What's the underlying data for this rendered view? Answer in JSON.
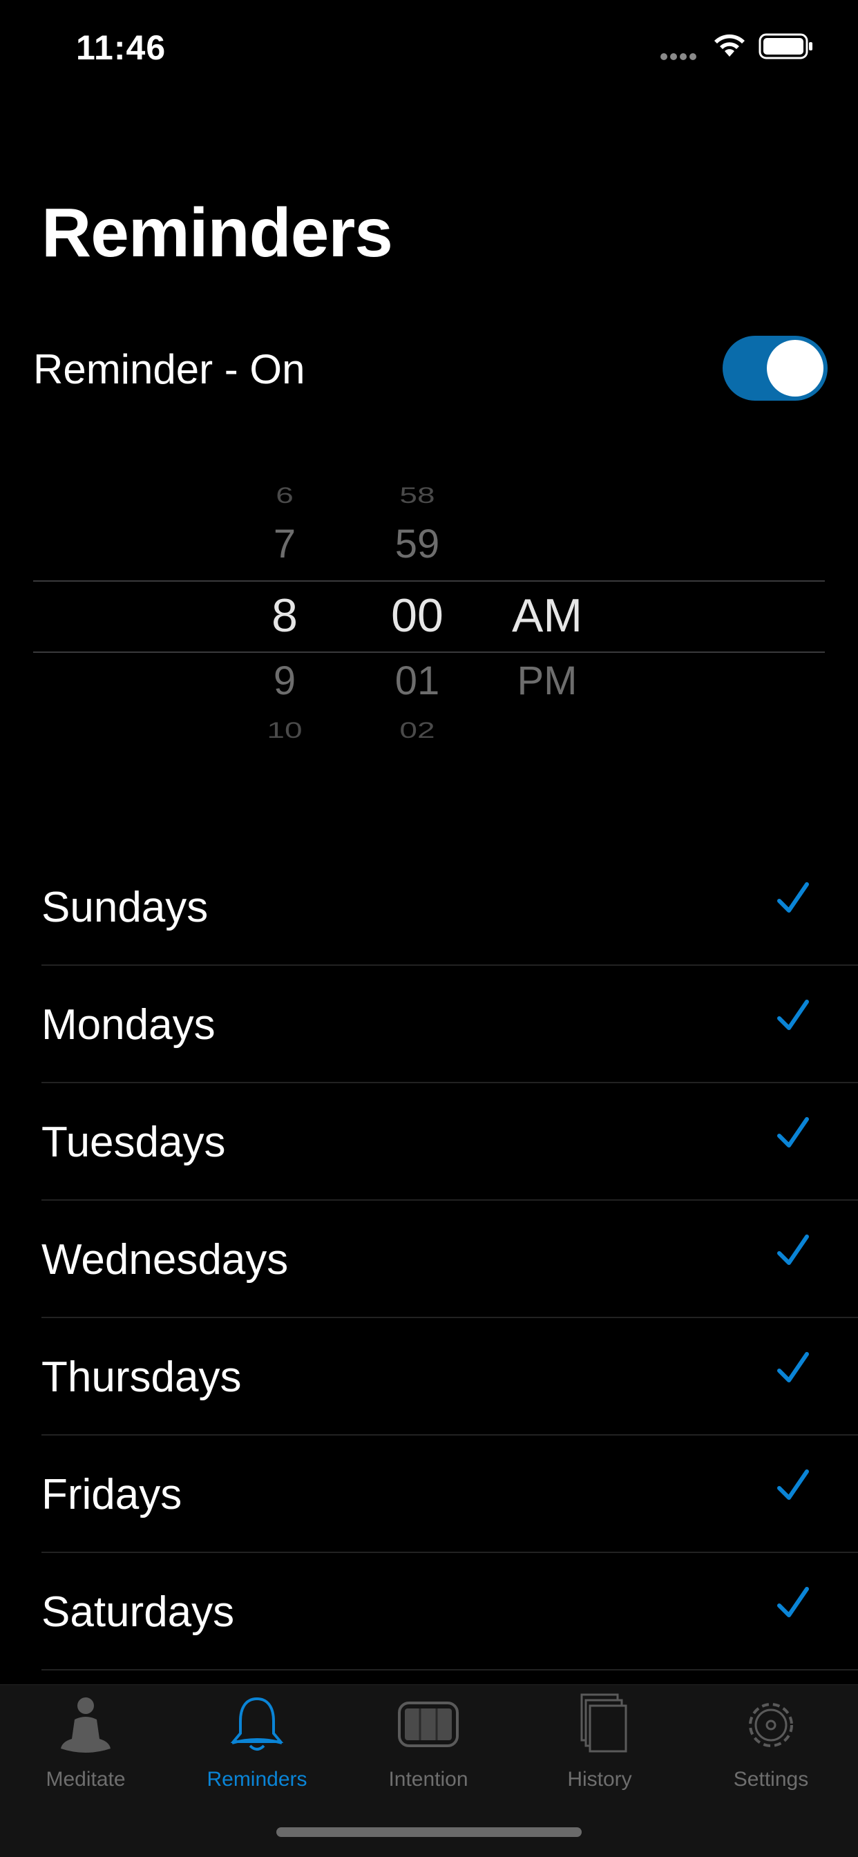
{
  "status_bar": {
    "time": "11:46"
  },
  "title": "Reminders",
  "reminder_toggle": {
    "label": "Reminder - On",
    "on": true
  },
  "time_picker": {
    "hours": [
      "6",
      "7",
      "8",
      "9",
      "10"
    ],
    "minutes": [
      "58",
      "59",
      "00",
      "01",
      "02"
    ],
    "periods": [
      "AM",
      "PM"
    ],
    "selected": {
      "hour": "8",
      "minute": "00",
      "period": "AM"
    }
  },
  "days": [
    {
      "label": "Sundays",
      "checked": true
    },
    {
      "label": "Mondays",
      "checked": true
    },
    {
      "label": "Tuesdays",
      "checked": true
    },
    {
      "label": "Wednesdays",
      "checked": true
    },
    {
      "label": "Thursdays",
      "checked": true
    },
    {
      "label": "Fridays",
      "checked": true
    },
    {
      "label": "Saturdays",
      "checked": true
    }
  ],
  "tabs": [
    {
      "label": "Meditate",
      "icon": "meditate-icon",
      "active": false
    },
    {
      "label": "Reminders",
      "icon": "bell-icon",
      "active": true
    },
    {
      "label": "Intention",
      "icon": "intention-icon",
      "active": false
    },
    {
      "label": "History",
      "icon": "history-icon",
      "active": false
    },
    {
      "label": "Settings",
      "icon": "gear-icon",
      "active": false
    }
  ],
  "colors": {
    "accent": "#0a84d6",
    "toggle_on": "#0a6cab",
    "background": "#000000"
  }
}
